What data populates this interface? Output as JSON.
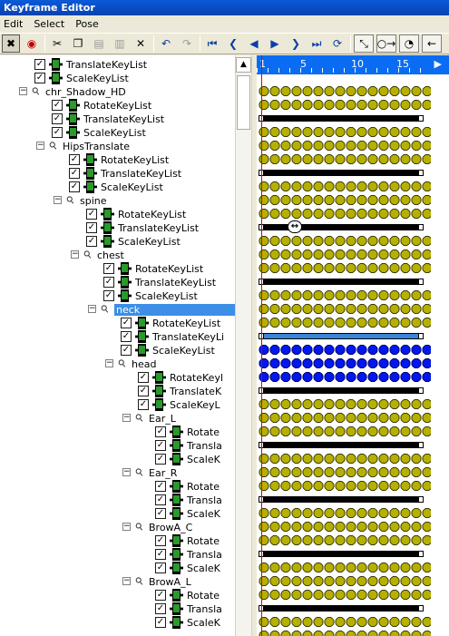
{
  "window": {
    "title": "Keyframe Editor"
  },
  "menu": [
    "Edit",
    "Select",
    "Pose"
  ],
  "toolbar": {
    "buttons": [
      {
        "name": "select-mode-icon",
        "glyph": "✖",
        "style": "pressed"
      },
      {
        "name": "record-icon",
        "glyph": "◉",
        "style": "red"
      },
      {
        "sep": true
      },
      {
        "name": "cut-icon",
        "glyph": "✂",
        "style": ""
      },
      {
        "name": "copy-icon",
        "glyph": "❐",
        "style": ""
      },
      {
        "name": "paste-icon",
        "glyph": "▤",
        "style": "gray"
      },
      {
        "name": "paste-special-icon",
        "glyph": "▥",
        "style": "gray"
      },
      {
        "name": "delete-icon",
        "glyph": "✕",
        "style": ""
      },
      {
        "sep": true
      },
      {
        "name": "undo-icon",
        "glyph": "↶",
        "style": "blue"
      },
      {
        "name": "redo-icon",
        "glyph": "↷",
        "style": "gray"
      },
      {
        "sep": true
      },
      {
        "name": "go-to-start-icon",
        "glyph": "⏮",
        "style": "blue"
      },
      {
        "name": "previous-key-icon",
        "glyph": "❮",
        "style": "blue"
      },
      {
        "name": "play-reverse-icon",
        "glyph": "◀",
        "style": "blue"
      },
      {
        "name": "play-icon",
        "glyph": "▶",
        "style": "blue"
      },
      {
        "name": "next-key-icon",
        "glyph": "❯",
        "style": "blue"
      },
      {
        "name": "go-to-end-icon",
        "glyph": "⏭",
        "style": "blue"
      },
      {
        "name": "loop-icon",
        "glyph": "⟳",
        "style": "blue"
      },
      {
        "sep": true
      },
      {
        "name": "move-keys-icon",
        "glyph": "⤡",
        "style": "raised"
      },
      {
        "name": "key-mode-icon",
        "glyph": "○→",
        "style": "raised"
      },
      {
        "name": "rotate-keys-icon",
        "glyph": "◔",
        "style": "raised"
      },
      {
        "name": "back-arrow-icon",
        "glyph": "←",
        "style": "raised"
      }
    ]
  },
  "timeline": {
    "ticks": [
      "1",
      "5",
      "10",
      "15"
    ],
    "scroll_arrow": "▶",
    "marker_glyph": "↔"
  },
  "tree": [
    {
      "label": "TranslateKeyList",
      "depth": 3,
      "kind": "list",
      "track": "keys"
    },
    {
      "label": "ScaleKeyList",
      "depth": 3,
      "kind": "list",
      "track": "keys"
    },
    {
      "label": "chr_Shadow_HD",
      "depth": 2,
      "kind": "bone",
      "track": "bar"
    },
    {
      "label": "RotateKeyList",
      "depth": 4,
      "kind": "list",
      "track": "keys"
    },
    {
      "label": "TranslateKeyList",
      "depth": 4,
      "kind": "list",
      "track": "keys"
    },
    {
      "label": "ScaleKeyList",
      "depth": 4,
      "kind": "list",
      "track": "keys"
    },
    {
      "label": "HipsTranslate",
      "depth": 3,
      "kind": "bone",
      "track": "bar"
    },
    {
      "label": "RotateKeyList",
      "depth": 5,
      "kind": "list",
      "track": "keys"
    },
    {
      "label": "TranslateKeyList",
      "depth": 5,
      "kind": "list",
      "track": "keys"
    },
    {
      "label": "ScaleKeyList",
      "depth": 5,
      "kind": "list",
      "track": "keys"
    },
    {
      "label": "spine",
      "depth": 4,
      "kind": "bone",
      "track": "bar",
      "marker": true
    },
    {
      "label": "RotateKeyList",
      "depth": 6,
      "kind": "list",
      "track": "keys"
    },
    {
      "label": "TranslateKeyList",
      "depth": 6,
      "kind": "list",
      "track": "keys"
    },
    {
      "label": "ScaleKeyList",
      "depth": 6,
      "kind": "list",
      "track": "keys"
    },
    {
      "label": "chest",
      "depth": 5,
      "kind": "bone",
      "track": "bar"
    },
    {
      "label": "RotateKeyList",
      "depth": 7,
      "kind": "list",
      "track": "keys"
    },
    {
      "label": "TranslateKeyList",
      "depth": 7,
      "kind": "list",
      "track": "keys"
    },
    {
      "label": "ScaleKeyList",
      "depth": 7,
      "kind": "list",
      "track": "keys"
    },
    {
      "label": "neck",
      "depth": 6,
      "kind": "bone",
      "track": "bar-blue",
      "selected": true
    },
    {
      "label": "RotateKeyList",
      "depth": 8,
      "kind": "list",
      "track": "keys-blue"
    },
    {
      "label": "TranslateKeyLi",
      "depth": 8,
      "kind": "list",
      "track": "keys-blue"
    },
    {
      "label": "ScaleKeyList",
      "depth": 8,
      "kind": "list",
      "track": "keys-blue"
    },
    {
      "label": "head",
      "depth": 7,
      "kind": "bone",
      "track": "bar"
    },
    {
      "label": "RotateKeyl",
      "depth": 9,
      "kind": "list",
      "track": "keys"
    },
    {
      "label": "TranslateK",
      "depth": 9,
      "kind": "list",
      "track": "keys"
    },
    {
      "label": "ScaleKeyL",
      "depth": 9,
      "kind": "list",
      "track": "keys"
    },
    {
      "label": "Ear_L",
      "depth": 8,
      "kind": "bone",
      "track": "bar"
    },
    {
      "label": "Rotate",
      "depth": 10,
      "kind": "list",
      "track": "keys"
    },
    {
      "label": "Transla",
      "depth": 10,
      "kind": "list",
      "track": "keys"
    },
    {
      "label": "ScaleK",
      "depth": 10,
      "kind": "list",
      "track": "keys"
    },
    {
      "label": "Ear_R",
      "depth": 8,
      "kind": "bone",
      "track": "bar"
    },
    {
      "label": "Rotate",
      "depth": 10,
      "kind": "list",
      "track": "keys"
    },
    {
      "label": "Transla",
      "depth": 10,
      "kind": "list",
      "track": "keys"
    },
    {
      "label": "ScaleK",
      "depth": 10,
      "kind": "list",
      "track": "keys"
    },
    {
      "label": "BrowA_C",
      "depth": 8,
      "kind": "bone",
      "track": "bar"
    },
    {
      "label": "Rotate",
      "depth": 10,
      "kind": "list",
      "track": "keys"
    },
    {
      "label": "Transla",
      "depth": 10,
      "kind": "list",
      "track": "keys"
    },
    {
      "label": "ScaleK",
      "depth": 10,
      "kind": "list",
      "track": "keys"
    },
    {
      "label": "BrowA_L",
      "depth": 8,
      "kind": "bone",
      "track": "bar"
    },
    {
      "label": "Rotate",
      "depth": 10,
      "kind": "list",
      "track": "keys"
    },
    {
      "label": "Transla",
      "depth": 10,
      "kind": "list",
      "track": "keys"
    },
    {
      "label": "ScaleK",
      "depth": 10,
      "kind": "list",
      "track": "keys"
    }
  ]
}
